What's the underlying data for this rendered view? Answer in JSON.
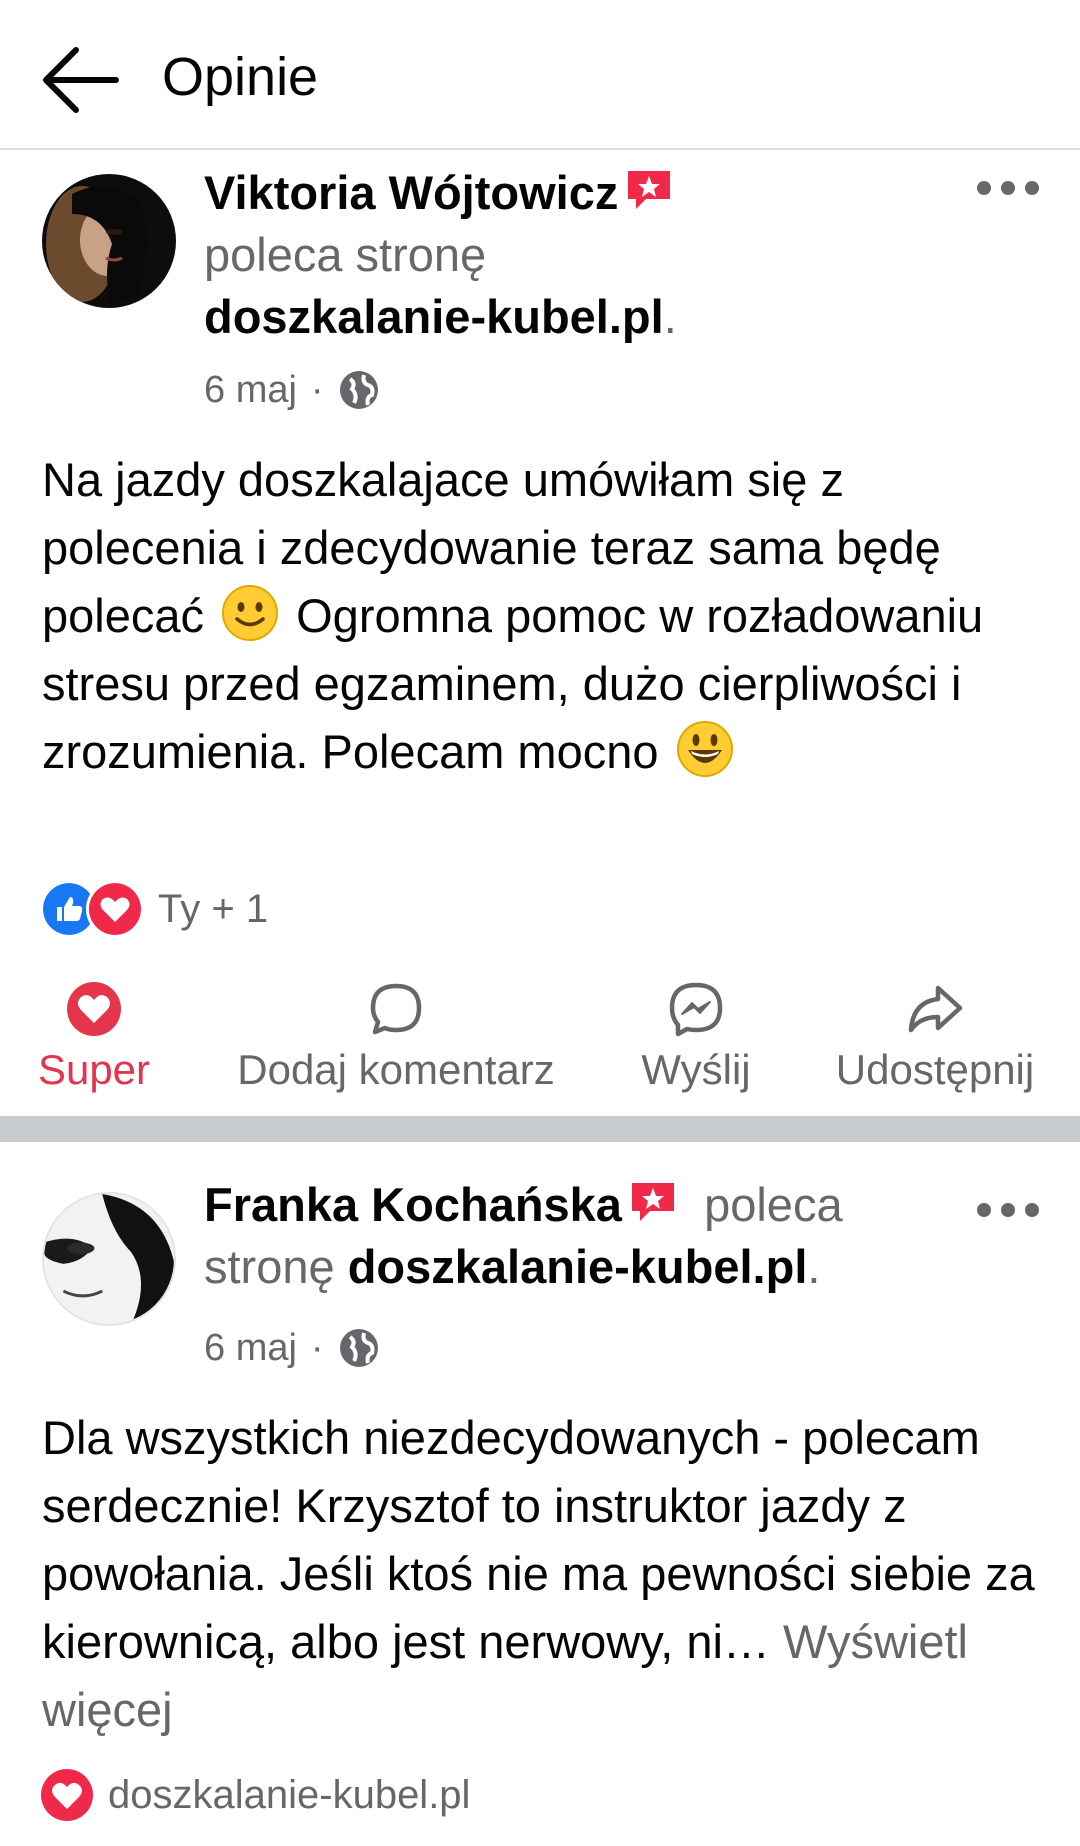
{
  "header": {
    "title": "Opinie"
  },
  "posts": [
    {
      "author": "Viktoria Wójtowicz",
      "recommends_text": "poleca stronę",
      "page": "doszkalanie-kubel.pl",
      "period": ".",
      "date": "6 maj",
      "separator": "·",
      "body_1": "Na jazdy doszkalajace umówiłam się z polecenia i zdecydowanie teraz sama będę polecać",
      "body_2": "Ogromna pomoc w rozładowaniu stresu przed egzaminem, dużo cierpliwości i zrozumienia. Polecam mocno",
      "reactions_count": "Ty + 1"
    },
    {
      "author": "Franka Kochańska",
      "recommends_word": "poleca",
      "recommends_word2": "stronę",
      "page": "doszkalanie-kubel.pl",
      "period": ".",
      "date": "6 maj",
      "separator": "·",
      "body": "Dla wszystkich niezdecydowanych - polecam serdecznie! Krzysztof to instruktor jazdy z powołania. Jeśli ktoś nie ma pewności siebie za kierownicą, albo jest nerwowy, ni…",
      "see_more": "Wyświetl więcej",
      "footer_site": "doszkalanie-kubel.pl"
    }
  ],
  "actions": {
    "super": "Super",
    "comment": "Dodaj komentarz",
    "send": "Wyślij",
    "share": "Udostępnij"
  },
  "colors": {
    "accent_red": "#e4354c",
    "like_blue": "#1877f2",
    "grey_text": "#65676b"
  },
  "icons": [
    "back-arrow-icon",
    "recommend-badge-icon",
    "more-icon",
    "globe-icon",
    "slight-smile-emoji",
    "grinning-emoji",
    "like-reaction-icon",
    "love-reaction-icon",
    "heart-icon",
    "comment-icon",
    "messenger-icon",
    "share-icon"
  ]
}
